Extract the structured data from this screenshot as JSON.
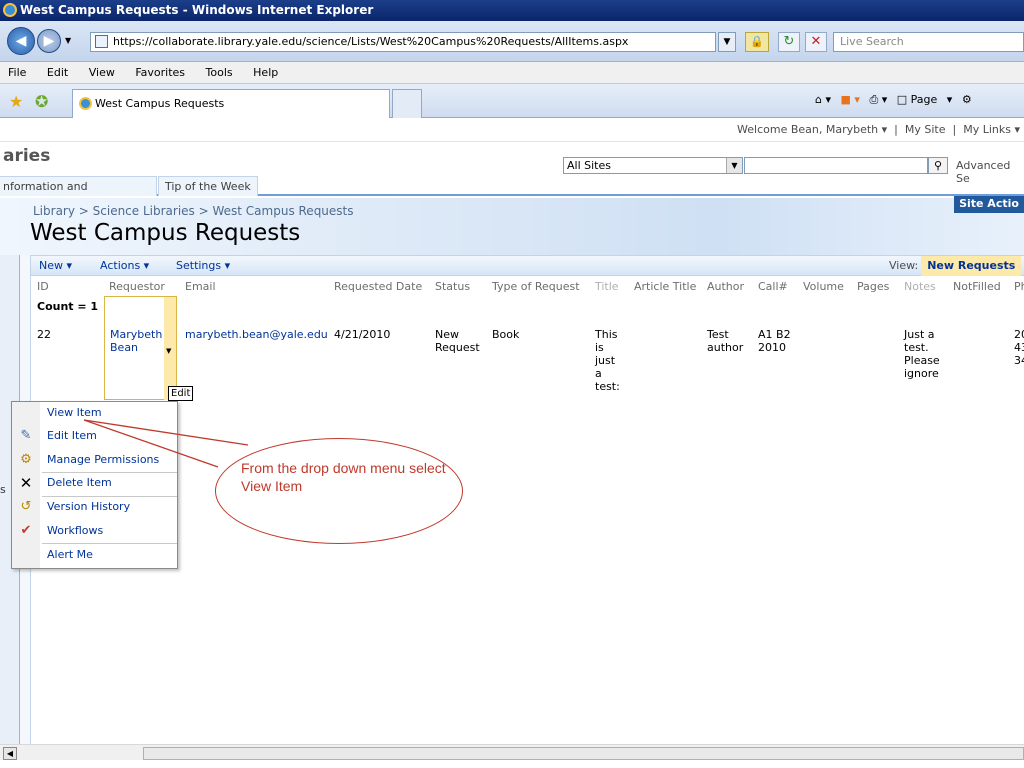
{
  "browser": {
    "window_title": "West Campus Requests - Windows Internet Explorer",
    "url": "https://collaborate.library.yale.edu/science/Lists/West%20Campus%20Requests/AllItems.aspx",
    "live_search_placeholder": "Live Search",
    "menu": [
      "File",
      "Edit",
      "View",
      "Favorites",
      "Tools",
      "Help"
    ],
    "tab_title": "West Campus Requests",
    "page_menu_label": "Page"
  },
  "site": {
    "welcome": "Welcome Bean, Marybeth",
    "my_site": "My Site",
    "my_links": "My Links",
    "brand_fragment": "aries",
    "scope_value": "All Sites",
    "advanced_search": "Advanced Se",
    "tabs": [
      "nformation and Instructions",
      "Tip of the Week"
    ],
    "site_actions": "Site Actio"
  },
  "page": {
    "breadcrumb": "Library > Science Libraries > West Campus Requests",
    "title": "West Campus Requests"
  },
  "toolbar": {
    "new_label": "New",
    "actions_label": "Actions",
    "settings_label": "Settings",
    "view_label": "View:",
    "view_value": "New Requests"
  },
  "table": {
    "headers": [
      "ID",
      "Requestor",
      "Email",
      "Requested Date",
      "Status",
      "Type of Request",
      "Title",
      "Article Title",
      "Author",
      "Call#",
      "Volume",
      "Pages",
      "Notes",
      "NotFilled",
      "Ph"
    ],
    "count_label": "Count = 1",
    "row": {
      "id": "22",
      "requestor": "Marybeth Bean",
      "email": "marybeth.bean@yale.edu",
      "requested_date": "4/21/2010",
      "status": "New Request",
      "type": "Book",
      "title": "This is just a test:",
      "article_title": "",
      "author": "Test author",
      "call": "A1 B2 2010",
      "volume": "",
      "pages": "",
      "notes": "Just a test. Please ignore",
      "notfilled": "",
      "ph": "20 43 34"
    },
    "edit_tooltip": "Edit"
  },
  "context_menu": {
    "items": [
      "View Item",
      "Edit Item",
      "Manage Permissions",
      "Delete Item",
      "Version History",
      "Workflows",
      "Alert Me"
    ]
  },
  "annotation": {
    "text": "From the drop down menu select View Item",
    "color": "#c0392b"
  },
  "side_stub": "s"
}
